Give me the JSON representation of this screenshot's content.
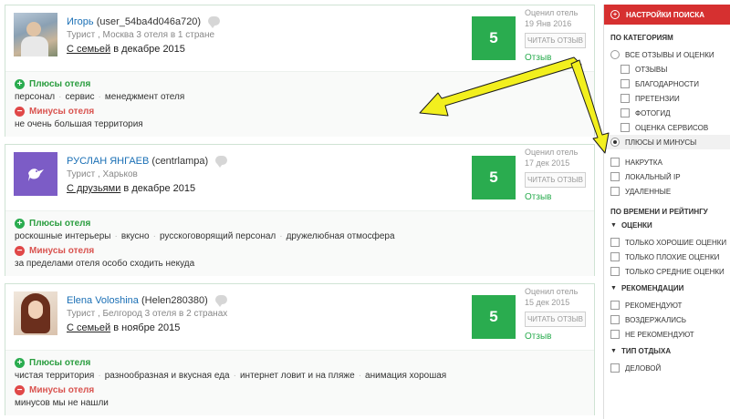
{
  "reviews": [
    {
      "user_name": "Игорь",
      "user_nick": "(user_54ba4d046a720)",
      "meta": "Турист , Москва 3 отеля в 1 стране",
      "trip_with": "С семьей",
      "trip_when": " в декабре 2015",
      "score": "5",
      "rated_label": "Оценил отель",
      "rated_date": "19 Янв 2016",
      "read_button": "ЧИТАТЬ ОТЗЫВ",
      "review_type": "Отзыв",
      "pros_title": "Плюсы отеля",
      "pros": [
        "персонал",
        "сервис",
        "менеджмент отеля"
      ],
      "cons_title": "Минусы отеля",
      "cons": [
        "не очень большая территория"
      ]
    },
    {
      "user_name": "РУСЛАН ЯНГАЕВ",
      "user_nick": "(centrlampa)",
      "meta": "Турист , Харьков",
      "trip_with": "С друзьями",
      "trip_when": " в декабре 2015",
      "score": "5",
      "rated_label": "Оценил отель",
      "rated_date": "17 дек 2015",
      "read_button": "ЧИТАТЬ ОТЗЫВ",
      "review_type": "Отзыв",
      "pros_title": "Плюсы отеля",
      "pros": [
        "роскошные интерьеры",
        "вкусно",
        "русскоговорящий персонал",
        "дружелюбная отмосфера"
      ],
      "cons_title": "Минусы отеля",
      "cons": [
        "за пределами отеля особо сходить некуда"
      ]
    },
    {
      "user_name": "Elena Voloshina",
      "user_nick": "(Helen280380)",
      "meta": "Турист , Белгород 3 отеля в 2 странах",
      "trip_with": "С семьей",
      "trip_when": " в ноябре 2015",
      "score": "5",
      "rated_label": "Оценил отель",
      "rated_date": "15 дек 2015",
      "read_button": "ЧИТАТЬ ОТЗЫВ",
      "review_type": "Отзыв",
      "pros_title": "Плюсы отеля",
      "pros": [
        "чистая территория",
        "разнообразная и вкусная еда",
        "интернет ловит и на пляже",
        "анимация хорошая"
      ],
      "cons_title": "Минусы отеля",
      "cons": [
        "минусов мы не нашли"
      ]
    }
  ],
  "sidebar": {
    "header": "НАСТРОЙКИ ПОИСКА",
    "section_categories": "ПО КАТЕГОРИЯМ",
    "all_reviews": "ВСЕ ОТЗЫВЫ И ОЦЕНКИ",
    "reviews": "ОТЗЫВЫ",
    "thanks": "БЛАГОДАРНОСТИ",
    "claims": "ПРЕТЕНЗИИ",
    "photoguide": "ФОТОГИД",
    "service_rating": "ОЦЕНКА СЕРВИСОВ",
    "pros_cons": "ПЛЮСЫ И МИНУСЫ",
    "cheat": "НАКРУТКА",
    "local_ip": "ЛОКАЛЬНЫЙ IP",
    "deleted": "УДАЛЕННЫЕ",
    "section_time": "ПО ВРЕМЕНИ И РЕЙТИНГУ",
    "ratings": "ОЦЕНКИ",
    "only_good": "ТОЛЬКО ХОРОШИЕ ОЦЕНКИ",
    "only_bad": "ТОЛЬКО ПЛОХИЕ ОЦЕНКИ",
    "only_avg": "ТОЛЬКО СРЕДНИЕ ОЦЕНКИ",
    "recommendations": "РЕКОМЕНДАЦИИ",
    "recommend": "РЕКОМЕНДУЮТ",
    "abstained": "ВОЗДЕРЖАЛИСЬ",
    "not_recommend": "НЕ РЕКОМЕНДУЮТ",
    "vacation_type": "ТИП ОТДЫХА",
    "business": "ДЕЛОВОЙ"
  },
  "colors": {
    "accent_red": "#d63030",
    "score_green": "#2aac4f",
    "arrow_yellow": "#f2ef1e"
  }
}
